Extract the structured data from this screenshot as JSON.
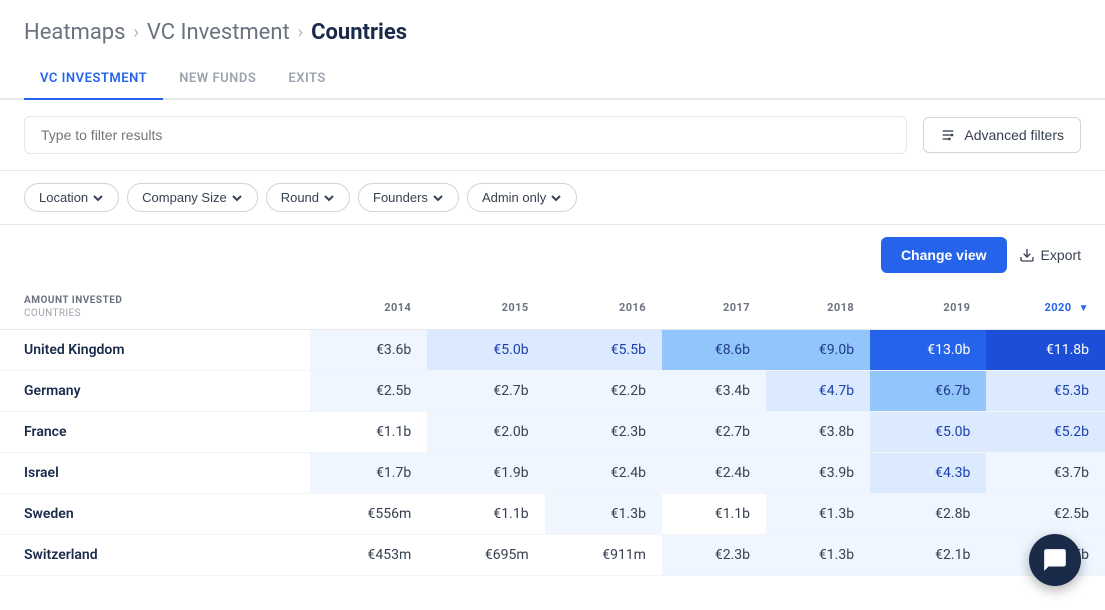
{
  "breadcrumb": {
    "items": [
      {
        "label": "Heatmaps",
        "active": false
      },
      {
        "label": "VC Investment",
        "active": false
      },
      {
        "label": "Countries",
        "active": true
      }
    ]
  },
  "tabs": [
    {
      "label": "VC INVESTMENT",
      "active": true
    },
    {
      "label": "NEW FUNDS",
      "active": false
    },
    {
      "label": "EXITS",
      "active": false
    }
  ],
  "search": {
    "placeholder": "Type to filter results"
  },
  "advanced_filters_label": "Advanced filters",
  "filters": [
    {
      "label": "Location"
    },
    {
      "label": "Company Size"
    },
    {
      "label": "Round"
    },
    {
      "label": "Founders"
    },
    {
      "label": "Admin only"
    }
  ],
  "table_controls": {
    "change_view": "Change view",
    "export": "Export"
  },
  "table": {
    "header_amount": "AMOUNT INVESTED",
    "header_countries": "Countries",
    "columns": [
      "2014",
      "2015",
      "2016",
      "2017",
      "2018",
      "2019",
      "2020"
    ],
    "rows": [
      {
        "country": "United Kingdom",
        "values": [
          "€3.6b",
          "€5.0b",
          "€5.5b",
          "€8.6b",
          "€9.0b",
          "€13.0b",
          "€11.8b"
        ],
        "styles": [
          "cell-pale",
          "cell-light",
          "cell-light",
          "cell-mid",
          "cell-mid",
          "cell-dark",
          "cell-highlight"
        ]
      },
      {
        "country": "Germany",
        "values": [
          "€2.5b",
          "€2.7b",
          "€2.2b",
          "€3.4b",
          "€4.7b",
          "€6.7b",
          "€5.3b"
        ],
        "styles": [
          "cell-pale",
          "cell-pale",
          "cell-pale",
          "cell-pale",
          "cell-light",
          "cell-mid",
          "cell-light"
        ]
      },
      {
        "country": "France",
        "values": [
          "€1.1b",
          "€2.0b",
          "€2.3b",
          "€2.7b",
          "€3.8b",
          "€5.0b",
          "€5.2b"
        ],
        "styles": [
          "cell-white",
          "cell-pale",
          "cell-pale",
          "cell-pale",
          "cell-pale",
          "cell-light",
          "cell-light"
        ]
      },
      {
        "country": "Israel",
        "values": [
          "€1.7b",
          "€1.9b",
          "€2.4b",
          "€2.4b",
          "€3.9b",
          "€4.3b",
          "€3.7b"
        ],
        "styles": [
          "cell-pale",
          "cell-pale",
          "cell-pale",
          "cell-pale",
          "cell-pale",
          "cell-light",
          "cell-pale"
        ]
      },
      {
        "country": "Sweden",
        "values": [
          "€556m",
          "€1.1b",
          "€1.3b",
          "€1.1b",
          "€1.3b",
          "€2.8b",
          "€2.5b"
        ],
        "styles": [
          "cell-white",
          "cell-white",
          "cell-pale",
          "cell-white",
          "cell-pale",
          "cell-pale",
          "cell-pale"
        ]
      },
      {
        "country": "Switzerland",
        "values": [
          "€453m",
          "€695m",
          "€911m",
          "€2.3b",
          "€1.3b",
          "€2.1b",
          "€1.5b"
        ],
        "styles": [
          "cell-white",
          "cell-white",
          "cell-white",
          "cell-pale",
          "cell-pale",
          "cell-pale",
          "cell-pale"
        ]
      }
    ]
  }
}
